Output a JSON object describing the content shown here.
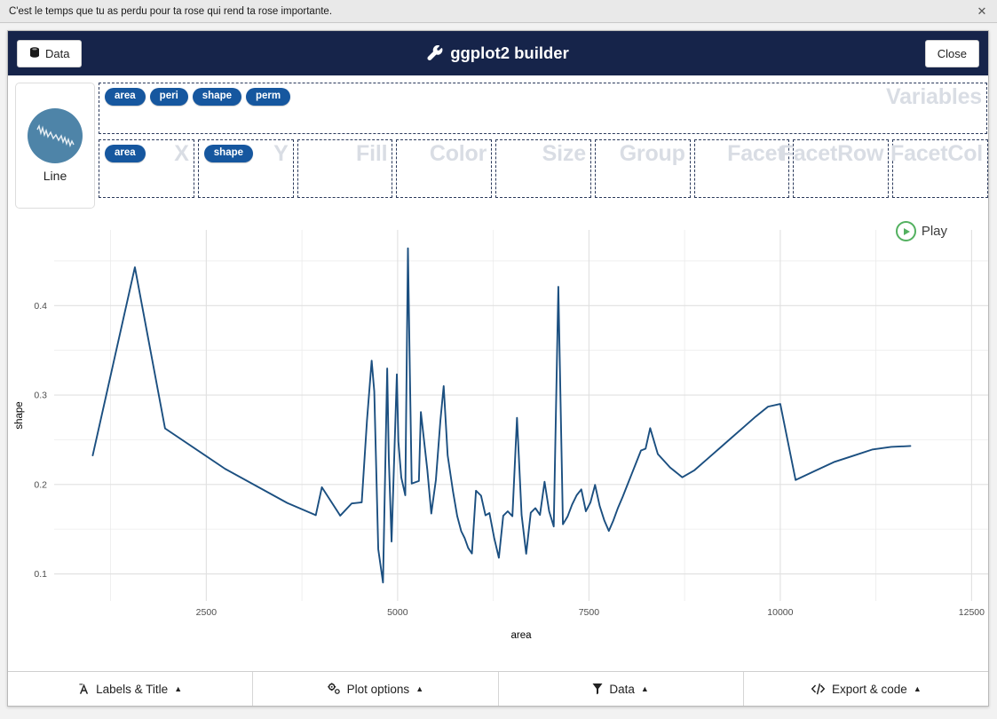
{
  "window": {
    "title": "C'est le temps que tu as perdu pour ta rose qui rend ta rose importante.",
    "close_glyph": "✕"
  },
  "header": {
    "data_button": "Data",
    "data_icon": "database-icon",
    "title": "ggplot2 builder",
    "title_icon": "wrench-icon",
    "close_button": "Close",
    "bg_color": "#16244a"
  },
  "geom": {
    "label": "Line",
    "icon": "line-chart-icon",
    "circle_color": "#4e84a8"
  },
  "variables": {
    "title": "Variables",
    "pills": [
      "area",
      "peri",
      "shape",
      "perm"
    ],
    "pill_color": "#16579f"
  },
  "aesthetics": [
    {
      "title": "X",
      "pills": [
        "area"
      ]
    },
    {
      "title": "Y",
      "pills": [
        "shape"
      ]
    },
    {
      "title": "Fill",
      "pills": []
    },
    {
      "title": "Color",
      "pills": []
    },
    {
      "title": "Size",
      "pills": []
    },
    {
      "title": "Group",
      "pills": []
    },
    {
      "title": "Facet",
      "pills": []
    },
    {
      "title": "FacetRow",
      "pills": []
    },
    {
      "title": "FacetCol",
      "pills": []
    }
  ],
  "play": {
    "label": "Play",
    "icon": "play-circle-icon",
    "color": "#53b160"
  },
  "footer": {
    "buttons": [
      {
        "label": "Labels & Title",
        "icon": "font-icon",
        "caret": "▲"
      },
      {
        "label": "Plot options",
        "icon": "sliders-icon",
        "caret": "▲"
      },
      {
        "label": "Data",
        "icon": "filter-icon",
        "caret": "▲"
      },
      {
        "label": "Export & code",
        "icon": "code-icon",
        "caret": "▲"
      }
    ]
  },
  "chart_data": {
    "type": "line",
    "title": "",
    "xlabel": "area",
    "ylabel": "shape",
    "line_color": "#1b4f80",
    "panel_bg": "#ffffff",
    "grid": true,
    "grid_color": "#ebebeb",
    "xlim": [
      1016,
      12212
    ],
    "ylim": [
      0.0903,
      0.4641
    ],
    "xticks": [
      2500,
      5000,
      7500,
      10000,
      12500
    ],
    "yticks": [
      0.1,
      0.2,
      0.3,
      0.4
    ],
    "x_minor": [
      1250,
      3750,
      6250,
      8750,
      11250
    ],
    "y_minor": [
      0.15,
      0.25,
      0.35,
      0.45
    ],
    "series": [
      {
        "name": "shape",
        "x": [
          1016,
          1567,
          1961,
          2747,
          3558,
          3931,
          4010,
          4250,
          4399,
          4531,
          4600,
          4661,
          4695,
          4747,
          4809,
          4864,
          4885,
          4921,
          4990,
          5010,
          5048,
          5100,
          5135,
          5160,
          5184,
          5278,
          5304,
          5388,
          5440,
          5500,
          5559,
          5602,
          5654,
          5724,
          5779,
          5831,
          5876,
          5922,
          5971,
          6024,
          6090,
          6148,
          6200,
          6261,
          6323,
          6380,
          6439,
          6500,
          6560,
          6620,
          6680,
          6740,
          6800,
          6860,
          6920,
          6980,
          7040,
          7100,
          7160,
          7220,
          7280,
          7340,
          7400,
          7460,
          7520,
          7580,
          7640,
          7700,
          7760,
          7820,
          7880,
          7940,
          8000,
          8060,
          8120,
          8180,
          8240,
          8300,
          8400,
          8560,
          8720,
          8880,
          9040,
          9200,
          9360,
          9520,
          9680,
          9840,
          10000,
          10200,
          10450,
          10700,
          10950,
          11200,
          11450,
          11700,
          11950,
          12212
        ],
        "y": [
          0.2325,
          0.4429,
          0.2627,
          0.2174,
          0.1793,
          0.1657,
          0.1969,
          0.1651,
          0.1787,
          0.18,
          0.272,
          0.3384,
          0.304,
          0.1276,
          0.0903,
          0.3297,
          0.229,
          0.1362,
          0.3232,
          0.248,
          0.2078,
          0.1879,
          0.4641,
          0.3248,
          0.201,
          0.2039,
          0.281,
          0.2165,
          0.1675,
          0.205,
          0.2715,
          0.31,
          0.2325,
          0.192,
          0.1645,
          0.1478,
          0.14,
          0.129,
          0.1228,
          0.193,
          0.1875,
          0.1655,
          0.168,
          0.1405,
          0.118,
          0.165,
          0.17,
          0.1645,
          0.2745,
          0.166,
          0.1225,
          0.1685,
          0.1735,
          0.166,
          0.203,
          0.17,
          0.153,
          0.421,
          0.1555,
          0.164,
          0.1775,
          0.188,
          0.1945,
          0.17,
          0.18,
          0.1995,
          0.176,
          0.16,
          0.148,
          0.16,
          0.174,
          0.186,
          0.199,
          0.212,
          0.225,
          0.238,
          0.24,
          0.263,
          0.234,
          0.219,
          0.208,
          0.216,
          0.228,
          0.24,
          0.252,
          0.264,
          0.276,
          0.287,
          0.29,
          0.205,
          0.215,
          0.225,
          0.232,
          0.239,
          0.242,
          0.243
        ]
      }
    ]
  }
}
